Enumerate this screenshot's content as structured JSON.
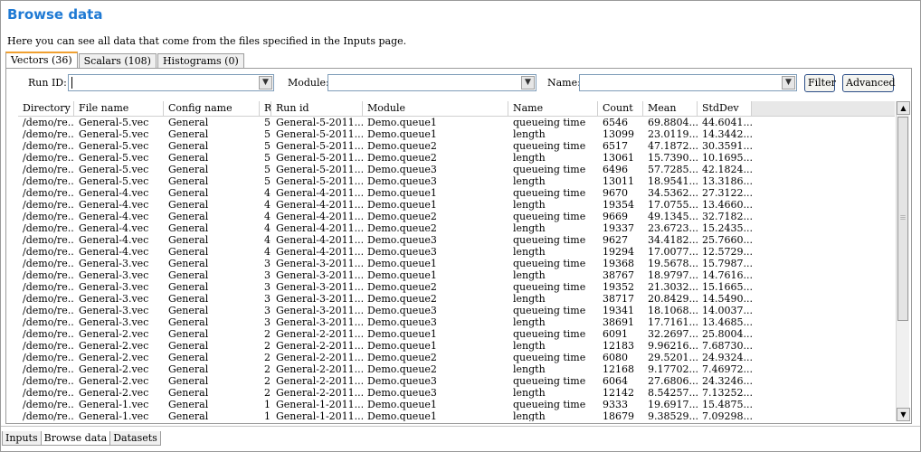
{
  "page": {
    "title": "Browse data",
    "description": "Here you can see all data that come from the files specified in the Inputs page."
  },
  "tabs": [
    {
      "label": "Vectors (36)",
      "active": true
    },
    {
      "label": "Scalars (108)",
      "active": false
    },
    {
      "label": "Histograms (0)",
      "active": false
    }
  ],
  "filters": {
    "run_id_label": "Run ID:",
    "run_id_value": "",
    "module_label": "Module:",
    "module_value": "",
    "name_label": "Name:",
    "name_value": "",
    "filter_button": "Filter",
    "advanced_button": "Advanced"
  },
  "table": {
    "columns": [
      "Directory",
      "File name",
      "Config name",
      "R",
      "Run id",
      "Module",
      "Name",
      "Count",
      "Mean",
      "StdDev"
    ],
    "rows": [
      [
        "/demo/re...",
        "General-5.vec",
        "General",
        "5",
        "General-5-2011...",
        "Demo.queue1",
        "queueing time",
        "6546",
        "69.8804...",
        "44.6041..."
      ],
      [
        "/demo/re...",
        "General-5.vec",
        "General",
        "5",
        "General-5-2011...",
        "Demo.queue1",
        "length",
        "13099",
        "23.0119...",
        "14.3442..."
      ],
      [
        "/demo/re...",
        "General-5.vec",
        "General",
        "5",
        "General-5-2011...",
        "Demo.queue2",
        "queueing time",
        "6517",
        "47.1872...",
        "30.3591..."
      ],
      [
        "/demo/re...",
        "General-5.vec",
        "General",
        "5",
        "General-5-2011...",
        "Demo.queue2",
        "length",
        "13061",
        "15.7390...",
        "10.1695..."
      ],
      [
        "/demo/re...",
        "General-5.vec",
        "General",
        "5",
        "General-5-2011...",
        "Demo.queue3",
        "queueing time",
        "6496",
        "57.7285...",
        "42.1824..."
      ],
      [
        "/demo/re...",
        "General-5.vec",
        "General",
        "5",
        "General-5-2011...",
        "Demo.queue3",
        "length",
        "13011",
        "18.9541...",
        "13.3186..."
      ],
      [
        "/demo/re...",
        "General-4.vec",
        "General",
        "4",
        "General-4-2011...",
        "Demo.queue1",
        "queueing time",
        "9670",
        "34.5362...",
        "27.3122..."
      ],
      [
        "/demo/re...",
        "General-4.vec",
        "General",
        "4",
        "General-4-2011...",
        "Demo.queue1",
        "length",
        "19354",
        "17.0755...",
        "13.4660..."
      ],
      [
        "/demo/re...",
        "General-4.vec",
        "General",
        "4",
        "General-4-2011...",
        "Demo.queue2",
        "queueing time",
        "9669",
        "49.1345...",
        "32.7182..."
      ],
      [
        "/demo/re...",
        "General-4.vec",
        "General",
        "4",
        "General-4-2011...",
        "Demo.queue2",
        "length",
        "19337",
        "23.6723...",
        "15.2435..."
      ],
      [
        "/demo/re...",
        "General-4.vec",
        "General",
        "4",
        "General-4-2011...",
        "Demo.queue3",
        "queueing time",
        "9627",
        "34.4182...",
        "25.7660..."
      ],
      [
        "/demo/re...",
        "General-4.vec",
        "General",
        "4",
        "General-4-2011...",
        "Demo.queue3",
        "length",
        "19294",
        "17.0077...",
        "12.5729..."
      ],
      [
        "/demo/re...",
        "General-3.vec",
        "General",
        "3",
        "General-3-2011...",
        "Demo.queue1",
        "queueing time",
        "19368",
        "19.5678...",
        "15.7987..."
      ],
      [
        "/demo/re...",
        "General-3.vec",
        "General",
        "3",
        "General-3-2011...",
        "Demo.queue1",
        "length",
        "38767",
        "18.9797...",
        "14.7616..."
      ],
      [
        "/demo/re...",
        "General-3.vec",
        "General",
        "3",
        "General-3-2011...",
        "Demo.queue2",
        "queueing time",
        "19352",
        "21.3032...",
        "15.1665..."
      ],
      [
        "/demo/re...",
        "General-3.vec",
        "General",
        "3",
        "General-3-2011...",
        "Demo.queue2",
        "length",
        "38717",
        "20.8429...",
        "14.5490..."
      ],
      [
        "/demo/re...",
        "General-3.vec",
        "General",
        "3",
        "General-3-2011...",
        "Demo.queue3",
        "queueing time",
        "19341",
        "18.1068...",
        "14.0037..."
      ],
      [
        "/demo/re...",
        "General-3.vec",
        "General",
        "3",
        "General-3-2011...",
        "Demo.queue3",
        "length",
        "38691",
        "17.7161...",
        "13.4685..."
      ],
      [
        "/demo/re...",
        "General-2.vec",
        "General",
        "2",
        "General-2-2011...",
        "Demo.queue1",
        "queueing time",
        "6091",
        "32.2697...",
        "25.8004..."
      ],
      [
        "/demo/re...",
        "General-2.vec",
        "General",
        "2",
        "General-2-2011...",
        "Demo.queue1",
        "length",
        "12183",
        "9.96216...",
        "7.68730..."
      ],
      [
        "/demo/re...",
        "General-2.vec",
        "General",
        "2",
        "General-2-2011...",
        "Demo.queue2",
        "queueing time",
        "6080",
        "29.5201...",
        "24.9324..."
      ],
      [
        "/demo/re...",
        "General-2.vec",
        "General",
        "2",
        "General-2-2011...",
        "Demo.queue2",
        "length",
        "12168",
        "9.17702...",
        "7.46972..."
      ],
      [
        "/demo/re...",
        "General-2.vec",
        "General",
        "2",
        "General-2-2011...",
        "Demo.queue3",
        "queueing time",
        "6064",
        "27.6806...",
        "24.3246..."
      ],
      [
        "/demo/re...",
        "General-2.vec",
        "General",
        "2",
        "General-2-2011...",
        "Demo.queue3",
        "length",
        "12142",
        "8.54257...",
        "7.13252..."
      ],
      [
        "/demo/re...",
        "General-1.vec",
        "General",
        "1",
        "General-1-2011...",
        "Demo.queue1",
        "queueing time",
        "9333",
        "19.6917...",
        "15.4875..."
      ],
      [
        "/demo/re...",
        "General-1.vec",
        "General",
        "1",
        "General-1-2011...",
        "Demo.queue1",
        "length",
        "18679",
        "9.38529...",
        "7.09298..."
      ]
    ]
  },
  "bottom_tabs": [
    {
      "label": "Inputs",
      "active": false
    },
    {
      "label": "Browse data",
      "active": true
    },
    {
      "label": "Datasets",
      "active": false
    }
  ],
  "icons": {
    "dropdown": "chevron-down-icon",
    "scroll_up": "arrow-up-icon",
    "scroll_down": "arrow-down-icon"
  },
  "colors": {
    "title": "#1f7ad4",
    "active_tab_accent": "#f0a030",
    "button_border": "#2c4e88"
  }
}
